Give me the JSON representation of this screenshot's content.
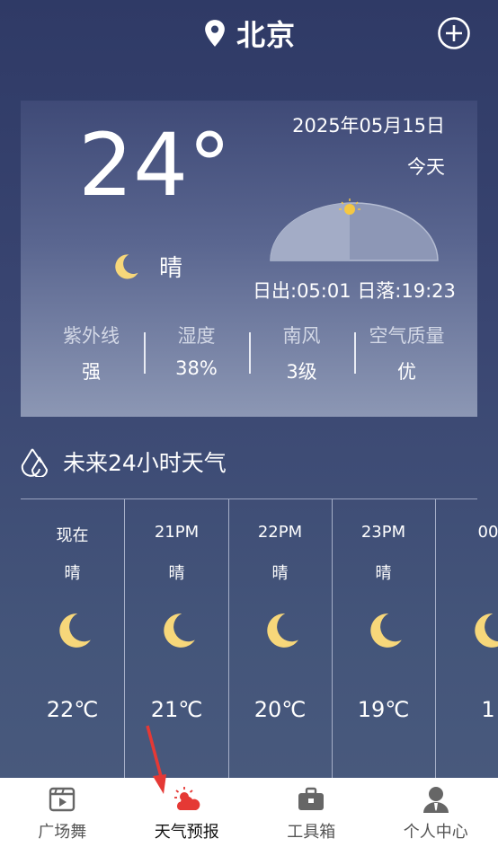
{
  "header": {
    "city": "北京"
  },
  "current": {
    "temperature": "24°",
    "condition": "晴",
    "date": "2025年05月15日",
    "day_label": "今天",
    "sunrise_sunset": "日出:05:01 日落:19:23",
    "stats": [
      {
        "label": "紫外线",
        "value": "强"
      },
      {
        "label": "湿度",
        "value": "38%"
      },
      {
        "label": "南风",
        "value": "3级"
      },
      {
        "label": "空气质量",
        "value": "优"
      }
    ]
  },
  "forecast": {
    "title": "未来24小时天气",
    "hours": [
      {
        "time": "现在",
        "condition": "晴",
        "temp": "22℃"
      },
      {
        "time": "21PM",
        "condition": "晴",
        "temp": "21℃"
      },
      {
        "time": "22PM",
        "condition": "晴",
        "temp": "20℃"
      },
      {
        "time": "23PM",
        "condition": "晴",
        "temp": "19℃"
      },
      {
        "time": "00",
        "condition": "",
        "temp": "1"
      }
    ]
  },
  "nav": {
    "items": [
      {
        "label": "广场舞",
        "icon": "video-icon"
      },
      {
        "label": "天气预报",
        "icon": "weather-icon",
        "active": true
      },
      {
        "label": "工具箱",
        "icon": "toolbox-icon"
      },
      {
        "label": "个人中心",
        "icon": "person-icon"
      }
    ]
  },
  "colors": {
    "moon": "#f7d77a",
    "accent": "#e53935",
    "sun": "#f5c842"
  }
}
